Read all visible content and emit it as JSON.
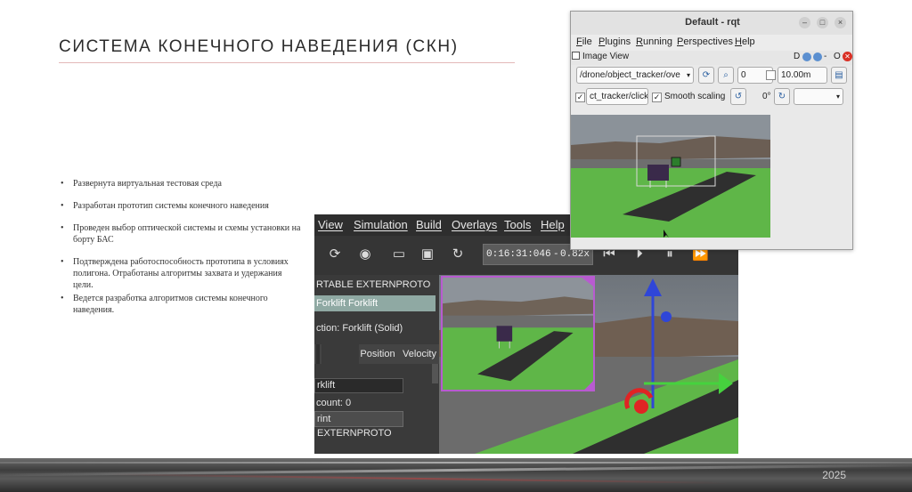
{
  "slide": {
    "title": "СИСТЕМА КОНЕЧНОГО НАВЕДЕНИЯ (СКН)",
    "bullets": [
      "Развернута виртуальная тестовая среда",
      "Разработан прототип системы конечного наведения",
      "Проведен выбор оптической системы и схемы установки на борту БАС",
      "Подтверждена работоспособность прототипа в условиях полигона. Отработаны алгоритмы захвата и удержания цели.",
      "Ведется разработка алгоритмов системы конечного наведения."
    ],
    "year": "2025"
  },
  "rqt": {
    "title": "Default - rqt",
    "menu": [
      "File",
      "Plugins",
      "Running",
      "Perspectives",
      "Help"
    ],
    "plugin_title": "Image View",
    "plugin_status": "D",
    "plugin_close": "O",
    "topic": "/drone/object_tracker/ove",
    "frame_value": "0",
    "max_range": "10.00m",
    "click_topic": "ct_tracker/click",
    "smooth_label": "Smooth scaling",
    "rotation": "0°",
    "check_mark": "✓"
  },
  "webots": {
    "menu": [
      "View",
      "Simulation",
      "Build",
      "Overlays",
      "Tools",
      "Help"
    ],
    "time": "0:16:31:046",
    "time_sep": "-",
    "speed": "0.82x",
    "tree": {
      "row1": "RTABLE EXTERNPROTO",
      "row2": "Forklift Forklift",
      "selection": "ction: Forklift (Solid)"
    },
    "tabs": [
      "Position",
      "Velocity"
    ],
    "name_field": "rklift",
    "count_label": "count: 0",
    "export_button": "rint EXTERNPROTO"
  }
}
